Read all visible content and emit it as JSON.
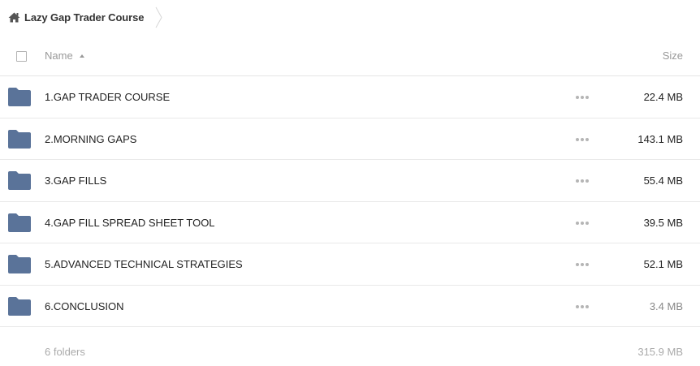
{
  "breadcrumb": {
    "icon": "home-icon",
    "label": "Lazy Gap Trader Course"
  },
  "table": {
    "header": {
      "name_label": "Name",
      "size_label": "Size",
      "sort": "ascending"
    },
    "rows": [
      {
        "icon": "folder-icon",
        "name": "1.GAP TRADER COURSE",
        "size": "22.4 MB"
      },
      {
        "icon": "folder-icon",
        "name": "2.MORNING GAPS",
        "size": "143.1 MB"
      },
      {
        "icon": "folder-icon",
        "name": "3.GAP FILLS",
        "size": "55.4 MB"
      },
      {
        "icon": "folder-icon",
        "name": "4.GAP FILL SPREAD SHEET TOOL",
        "size": "39.5 MB"
      },
      {
        "icon": "folder-icon",
        "name": "5.ADVANCED TECHNICAL STRATEGIES",
        "size": "52.1 MB"
      },
      {
        "icon": "folder-icon",
        "name": "6.CONCLUSION",
        "size": "3.4 MB"
      }
    ]
  },
  "footer": {
    "count": "6 folders",
    "total_size": "315.9 MB"
  },
  "colors": {
    "folder": "#5a7399",
    "muted": "#999999"
  }
}
